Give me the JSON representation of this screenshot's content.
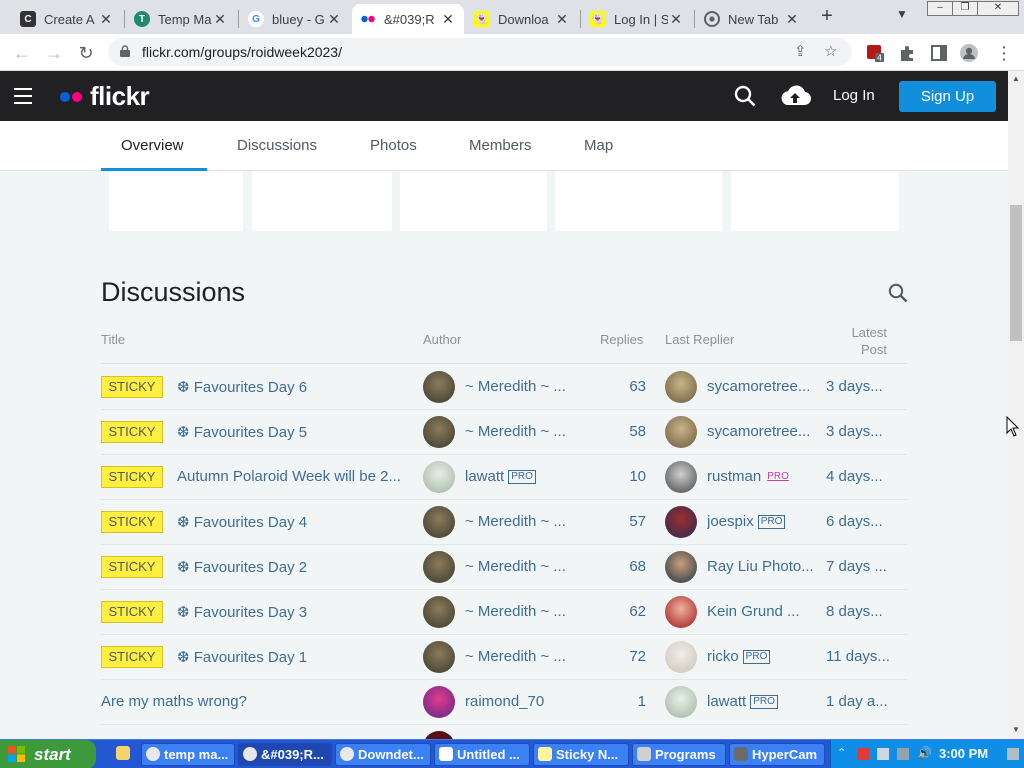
{
  "browser": {
    "tabs": [
      {
        "label": "Create A",
        "icon": "crp-icon"
      },
      {
        "label": "Temp Ma",
        "icon": "temp-mail-icon"
      },
      {
        "label": "bluey - G",
        "icon": "google-icon"
      },
      {
        "label": "&#039;R",
        "icon": "flickr-dots-icon"
      },
      {
        "label": "Downloa",
        "icon": "snapchat-icon"
      },
      {
        "label": "Log In | S",
        "icon": "snapchat-icon"
      },
      {
        "label": "New Tab",
        "icon": "chrome-icon"
      }
    ],
    "url": "flickr.com/groups/roidweek2023/"
  },
  "header": {
    "logo": "flickr",
    "login": "Log In",
    "signup": "Sign Up"
  },
  "subnav": {
    "tabs": [
      "Overview",
      "Discussions",
      "Photos",
      "Members",
      "Map"
    ]
  },
  "discussions": {
    "title": "Discussions",
    "columns": {
      "title": "Title",
      "author": "Author",
      "replies": "Replies",
      "last_replier": "Last Replier",
      "latest_post": "Latest Post"
    },
    "rows": [
      {
        "sticky": "STICKY",
        "topic": "❆ Favourites Day 6",
        "author": "~ Meredith ~ ...",
        "author_pro": "",
        "replies": "63",
        "last_replier": "sycamoretree...",
        "replier_pro": "",
        "latest": "3 days..."
      },
      {
        "sticky": "STICKY",
        "topic": "❆ Favourites Day 5",
        "author": "~ Meredith ~ ...",
        "author_pro": "",
        "replies": "58",
        "last_replier": "sycamoretree...",
        "replier_pro": "",
        "latest": "3 days..."
      },
      {
        "sticky": "STICKY",
        "topic": "Autumn Polaroid Week will be 2...",
        "author": "lawatt",
        "author_pro": "PRO",
        "replies": "10",
        "last_replier": "rustman",
        "replier_pro": "PRO",
        "latest": "4 days..."
      },
      {
        "sticky": "STICKY",
        "topic": "❆ Favourites Day 4",
        "author": "~ Meredith ~ ...",
        "author_pro": "",
        "replies": "57",
        "last_replier": "joespix",
        "replier_pro": "PRO",
        "latest": "6 days..."
      },
      {
        "sticky": "STICKY",
        "topic": "❆ Favourites Day 2",
        "author": "~ Meredith ~ ...",
        "author_pro": "",
        "replies": "68",
        "last_replier": "Ray Liu Photo...",
        "replier_pro": "",
        "latest": "7 days ..."
      },
      {
        "sticky": "STICKY",
        "topic": "❆ Favourites Day 3",
        "author": "~ Meredith ~ ...",
        "author_pro": "",
        "replies": "62",
        "last_replier": "Kein Grund ...",
        "replier_pro": "",
        "latest": "8 days..."
      },
      {
        "sticky": "STICKY",
        "topic": "❆ Favourites Day 1",
        "author": "~ Meredith ~ ...",
        "author_pro": "",
        "replies": "72",
        "last_replier": "ricko",
        "replier_pro": "PRO",
        "latest": "11 days..."
      },
      {
        "sticky": "",
        "topic": "Are my maths wrong?",
        "author": "raimond_70",
        "author_pro": "",
        "replies": "1",
        "last_replier": "lawatt",
        "replier_pro": "PRO",
        "latest": "1 day a..."
      }
    ]
  },
  "taskbar": {
    "start": "start",
    "items": [
      "temp ma...",
      "&#039;R...",
      "Downdet...",
      "Untitled ...",
      "Sticky N...",
      "Programs",
      "HyperCam"
    ],
    "clock": "3:00 PM"
  },
  "colors": {
    "flickr_blue": "#0063dc",
    "flickr_pink": "#ff0084",
    "signup_blue": "#128fdc",
    "sticky_yellow": "#ffef40",
    "link_blue": "#3e6d92"
  }
}
